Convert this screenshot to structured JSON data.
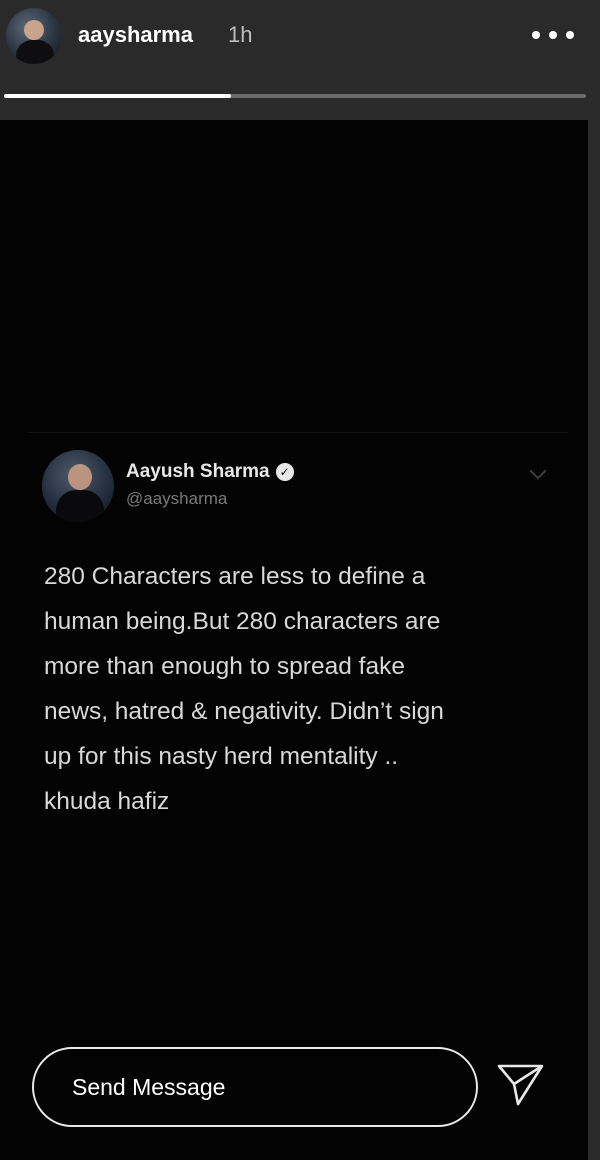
{
  "header": {
    "username": "aaysharma",
    "timestamp": "1h",
    "more_icon": "more-horizontal-icon",
    "progress_fraction": 0.39
  },
  "tweet": {
    "display_name": "Aayush Sharma",
    "handle": "@aaysharma",
    "verified_icon": "verified-badge-icon",
    "menu_icon": "chevron-down-icon",
    "body": "280 Characters are less to define a\nhuman being.But 280 characters are\nmore than enough to spread fake\nnews, hatred & negativity. Didn’t sign\nup for this nasty herd mentality ..\nkhuda hafiz"
  },
  "footer": {
    "message_placeholder": "Send Message",
    "send_icon": "paper-plane-icon"
  },
  "colors": {
    "background": "#030303",
    "header": "#2a2a2a",
    "text": "#d8d8d8",
    "handle": "#7a7a7a",
    "progress_track": "#6b6b6b",
    "progress_fill": "#ffffff"
  }
}
